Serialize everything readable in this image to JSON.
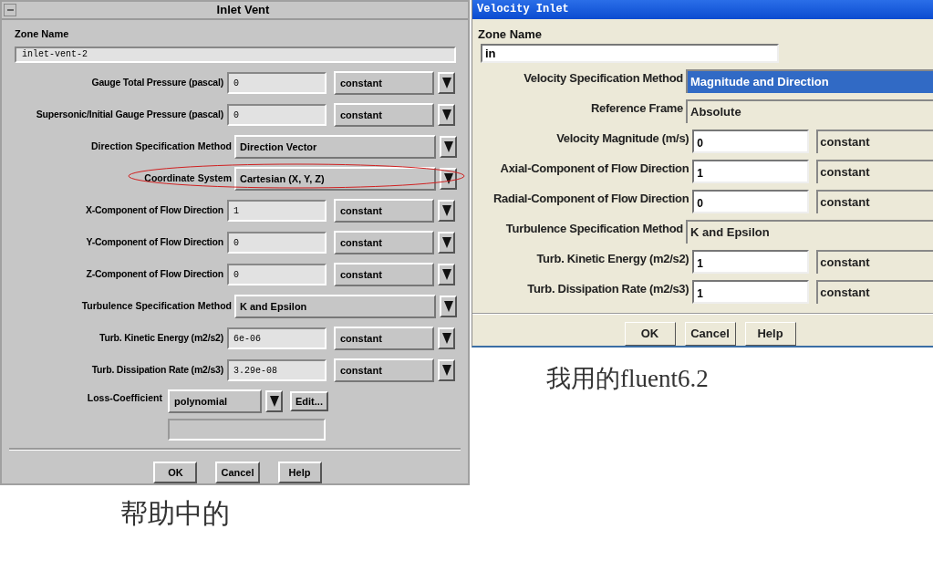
{
  "help_dialog": {
    "title": "Inlet Vent",
    "zone_name_label": "Zone Name",
    "zone_name": "inlet-vent-2",
    "rows": [
      {
        "kind": "field",
        "label": "Gauge Total Pressure (pascal)",
        "value": "0",
        "method": "constant",
        "circled": false
      },
      {
        "kind": "field",
        "label": "Supersonic/Initial Gauge Pressure (pascal)",
        "value": "0",
        "method": "constant",
        "circled": false
      },
      {
        "kind": "dropdown",
        "label": "Direction Specification Method",
        "value": "Direction Vector",
        "circled": false
      },
      {
        "kind": "dropdown",
        "label": "Coordinate System",
        "value": "Cartesian (X, Y, Z)",
        "circled": true
      },
      {
        "kind": "field",
        "label": "X-Component of Flow Direction",
        "value": "1",
        "method": "constant",
        "circled": false
      },
      {
        "kind": "field",
        "label": "Y-Component of Flow Direction",
        "value": "0",
        "method": "constant",
        "circled": false
      },
      {
        "kind": "field",
        "label": "Z-Component of Flow Direction",
        "value": "0",
        "method": "constant",
        "circled": false
      },
      {
        "kind": "dropdown",
        "label": "Turbulence Specification Method",
        "value": "K and Epsilon",
        "circled": false
      },
      {
        "kind": "field",
        "label": "Turb. Kinetic Energy (m2/s2)",
        "value": "6e-06",
        "method": "constant",
        "circled": false
      },
      {
        "kind": "field",
        "label": "Turb. Dissipation Rate (m2/s3)",
        "value": "3.29e-08",
        "method": "constant",
        "circled": false
      }
    ],
    "loss_coefficient": {
      "label": "Loss-Coefficient",
      "value": "polynomial",
      "button": "Edit..."
    },
    "buttons": [
      "OK",
      "Cancel",
      "Help"
    ]
  },
  "help_caption": "帮助中的",
  "my_dialog": {
    "title": "Velocity Inlet",
    "zone_name_label": "Zone Name",
    "zone_name": "in",
    "rows": [
      {
        "kind": "dropdown",
        "label": "Velocity Specification Method",
        "value": "Magnitude and Direction",
        "selected": true
      },
      {
        "kind": "dropdown",
        "label": "Reference Frame",
        "value": "Absolute",
        "selected": false
      },
      {
        "kind": "field",
        "label": "Velocity Magnitude (m/s)",
        "value": "0",
        "method": "constant"
      },
      {
        "kind": "field",
        "label": "Axial-Component of Flow Direction",
        "value": "1",
        "method": "constant"
      },
      {
        "kind": "field",
        "label": "Radial-Component of Flow Direction",
        "value": "0",
        "method": "constant"
      },
      {
        "kind": "dropdown",
        "label": "Turbulence Specification Method",
        "value": "K and Epsilon",
        "selected": false
      },
      {
        "kind": "field",
        "label": "Turb. Kinetic Energy (m2/s2)",
        "value": "1",
        "method": "constant"
      },
      {
        "kind": "field",
        "label": "Turb. Dissipation Rate (m2/s3)",
        "value": "1",
        "method": "constant"
      }
    ],
    "buttons": [
      "OK",
      "Cancel",
      "Help"
    ]
  },
  "my_caption": "我用的fluent6.2"
}
